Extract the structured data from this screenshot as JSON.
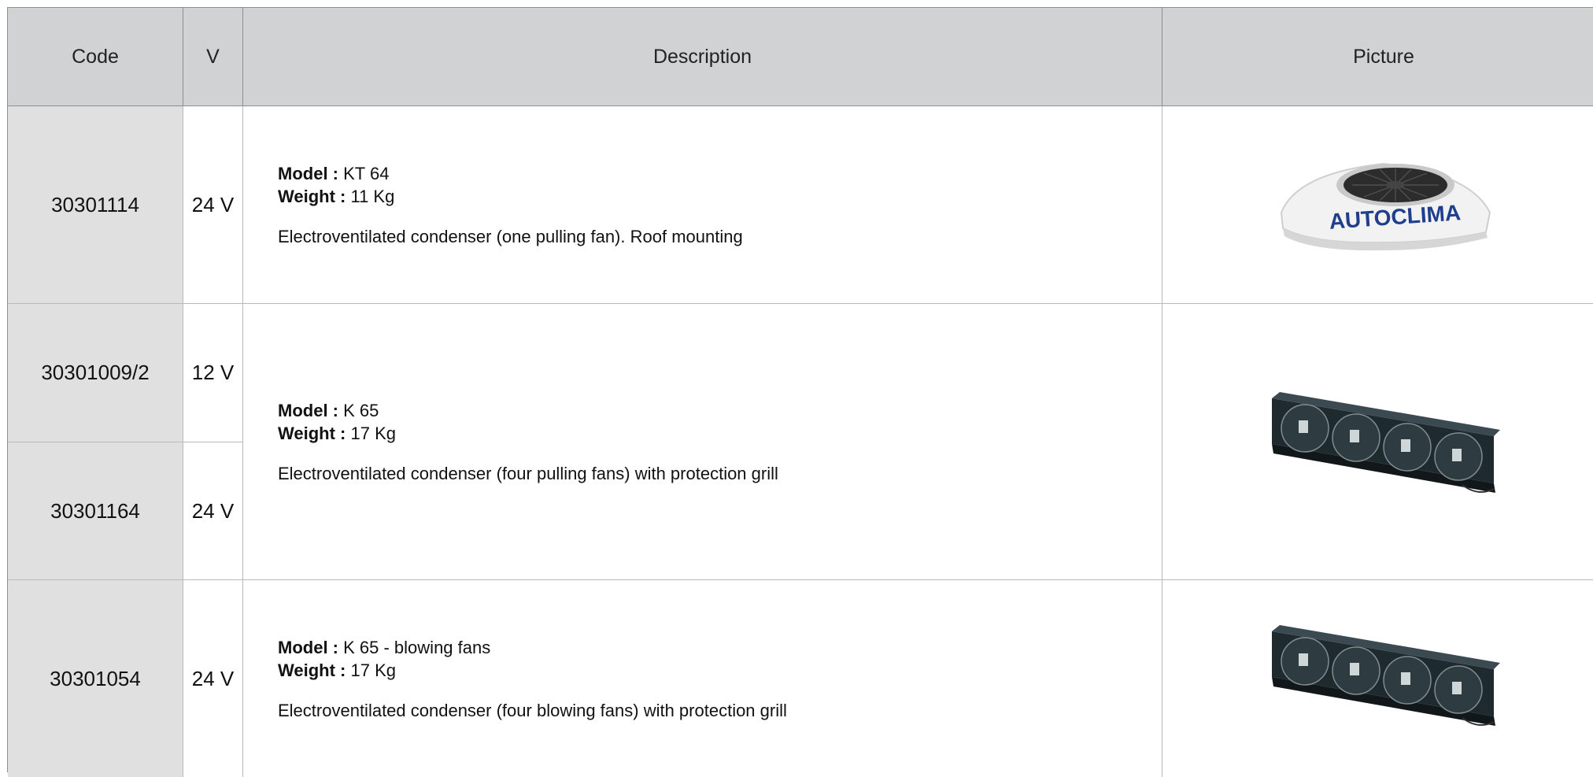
{
  "headers": {
    "code": "Code",
    "v": "V",
    "description": "Description",
    "picture": "Picture"
  },
  "rows": [
    {
      "code": "30301114",
      "v": "24 V",
      "model_label": "Model :",
      "model": "KT 64",
      "weight_label": "Weight :",
      "weight": "11 Kg",
      "text": "Electroventilated condenser (one pulling fan). Roof mounting",
      "picture_brand": "AUTOCLIMA"
    },
    {
      "codes": [
        {
          "code": "30301009/2",
          "v": "12 V"
        },
        {
          "code": "30301164",
          "v": "24 V"
        }
      ],
      "model_label": "Model :",
      "model": "K 65",
      "weight_label": "Weight :",
      "weight": "17 Kg",
      "text": "Electroventilated condenser (four pulling fans) with protection grill"
    },
    {
      "code": "30301054",
      "v": "24 V",
      "model_label": "Model :",
      "model": "K 65 - blowing fans",
      "weight_label": "Weight :",
      "weight": "17 Kg",
      "text": "Electroventilated condenser (four blowing fans) with protection grill"
    }
  ],
  "colors": {
    "header_bg": "#d1d2d4",
    "code_bg": "#e0e0e0",
    "border": "#b9b9b9"
  }
}
